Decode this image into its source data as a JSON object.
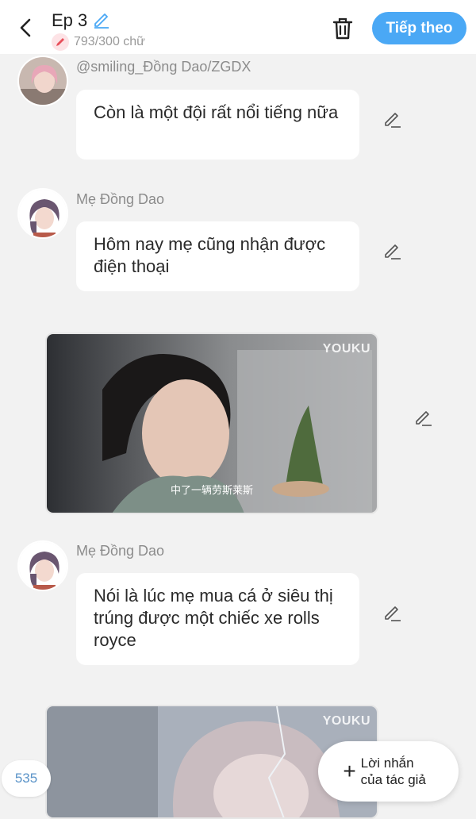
{
  "header": {
    "episode_title": "Ep 3",
    "word_count": "793/300 chữ",
    "next_label": "Tiếp theo"
  },
  "messages": [
    {
      "sender": "@smiling_Đồng Dao/ZGDX",
      "text": "Còn là một đội rất nổi tiếng nữa"
    },
    {
      "sender": "Mẹ Đồng Dao",
      "text": "Hôm nay mẹ cũng nhận được điện thoại"
    },
    {
      "sender": "Mẹ Đồng Dao",
      "text": "Nói là lúc mẹ mua cá ở siêu thị trúng được một chiếc xe rolls royce"
    }
  ],
  "media": [
    {
      "watermark": "YOUKU",
      "subtitle": "中了一辆劳斯莱斯"
    },
    {
      "watermark": "YOUKU"
    }
  ],
  "footer": {
    "counter": "535",
    "author_note_label": "Lời nhắn của tác giả"
  },
  "colors": {
    "accent": "#4aa8f5",
    "background": "#f2f2f2"
  }
}
